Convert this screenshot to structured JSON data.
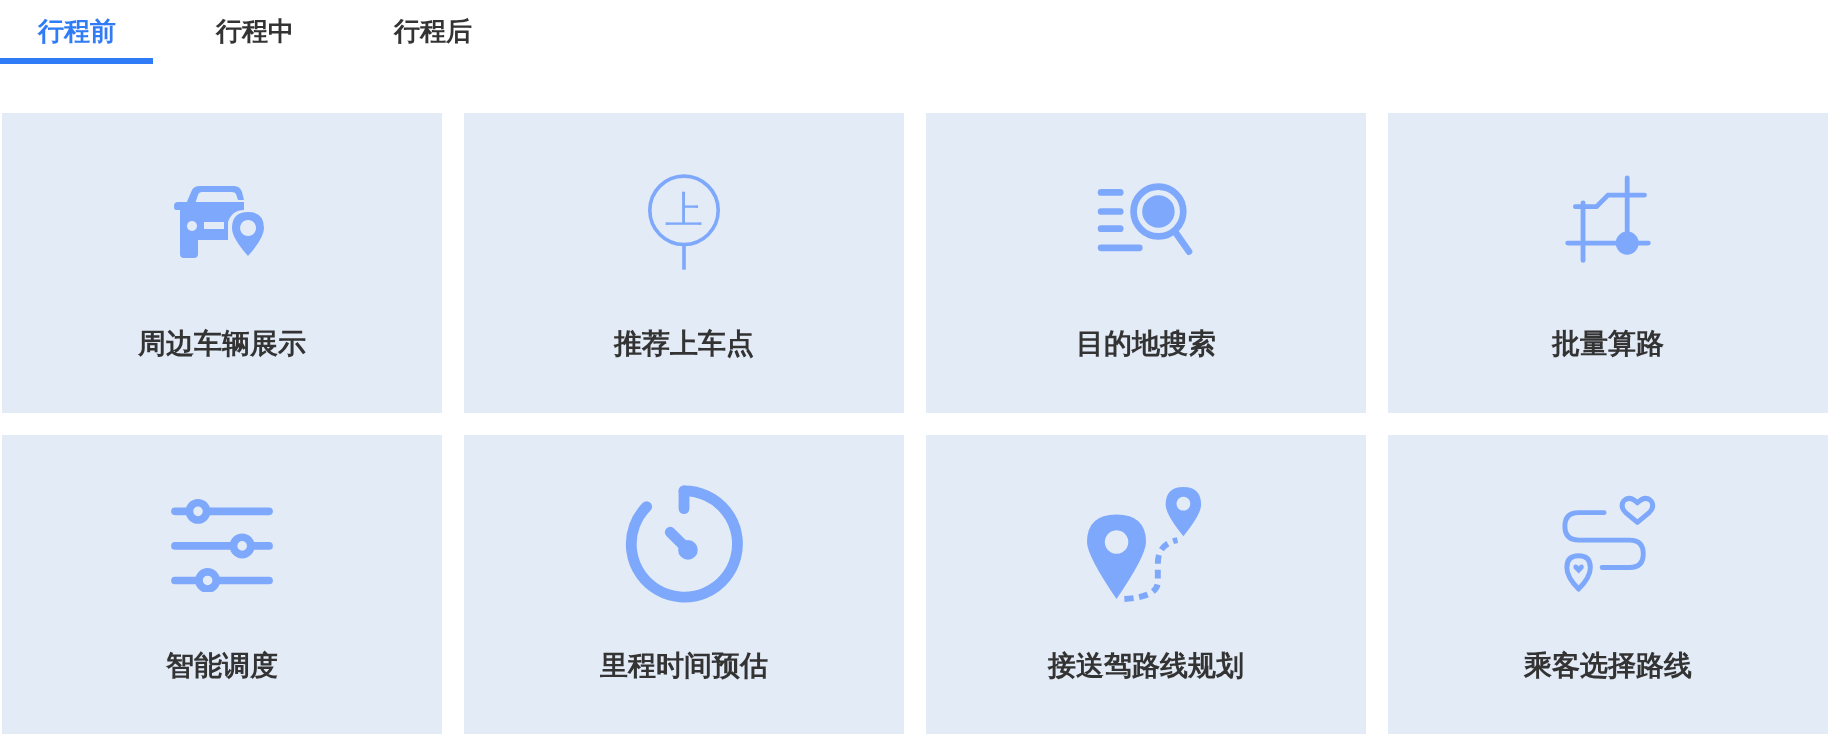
{
  "tabs": [
    {
      "label": "行程前",
      "selected": true
    },
    {
      "label": "行程中",
      "selected": false
    },
    {
      "label": "行程后",
      "selected": false
    }
  ],
  "cards": [
    {
      "title": "周边车辆展示"
    },
    {
      "title": "推荐上车点",
      "icon_text": "上"
    },
    {
      "title": "目的地搜索"
    },
    {
      "title": "批量算路"
    },
    {
      "title": "智能调度"
    },
    {
      "title": "里程时间预估"
    },
    {
      "title": "接送驾路线规划"
    },
    {
      "title": "乘客选择路线"
    }
  ]
}
